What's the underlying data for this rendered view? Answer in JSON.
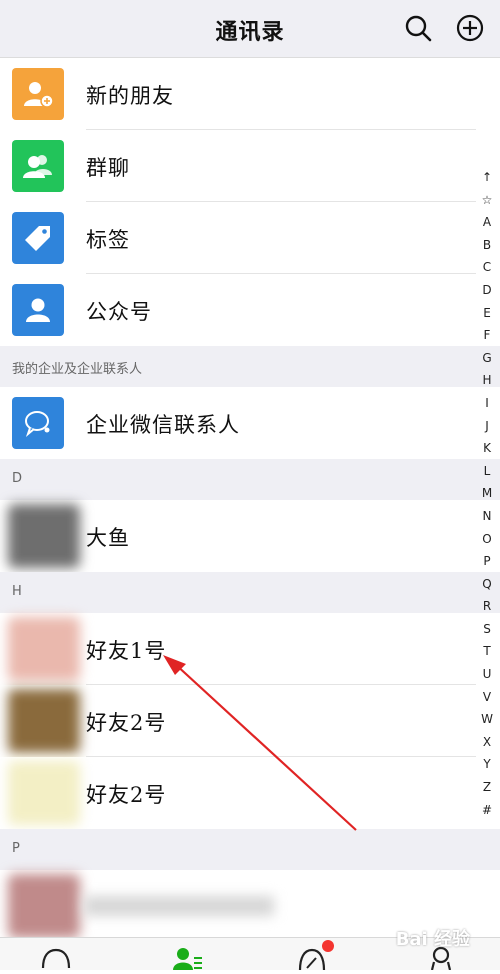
{
  "header": {
    "title": "通讯录"
  },
  "fixed_items": [
    {
      "label": "新的朋友",
      "icon": "add-friend-icon",
      "color": "#f5a33b"
    },
    {
      "label": "群聊",
      "icon": "group-chat-icon",
      "color": "#22c45a"
    },
    {
      "label": "标签",
      "icon": "tag-icon",
      "color": "#2f84db"
    },
    {
      "label": "公众号",
      "icon": "official-account-icon",
      "color": "#2f84db"
    }
  ],
  "enterprise_section": {
    "title": "我的企业及企业联系人",
    "item": {
      "label": "企业微信联系人",
      "icon": "enterprise-contact-icon",
      "color": "#2f84db"
    }
  },
  "groups": [
    {
      "letter": "D",
      "contacts": [
        {
          "name": "大鱼"
        }
      ]
    },
    {
      "letter": "H",
      "contacts": [
        {
          "name": "好友1号"
        },
        {
          "name": "好友2号"
        },
        {
          "name": "好友2号"
        }
      ]
    },
    {
      "letter": "P",
      "contacts": [
        {
          "name": ""
        }
      ]
    }
  ],
  "index_letters": [
    "↑",
    "☆",
    "A",
    "B",
    "C",
    "D",
    "E",
    "F",
    "G",
    "H",
    "I",
    "J",
    "K",
    "L",
    "M",
    "N",
    "O",
    "P",
    "Q",
    "R",
    "S",
    "T",
    "U",
    "V",
    "W",
    "X",
    "Y",
    "Z",
    "#"
  ],
  "tabs": [
    {
      "name": "chats-tab",
      "icon": "chat-bubble-icon"
    },
    {
      "name": "contacts-tab",
      "icon": "contacts-icon",
      "active": true
    },
    {
      "name": "discover-tab",
      "icon": "compass-icon",
      "badge": true
    },
    {
      "name": "me-tab",
      "icon": "person-icon"
    }
  ],
  "watermark": "Bai 经验"
}
